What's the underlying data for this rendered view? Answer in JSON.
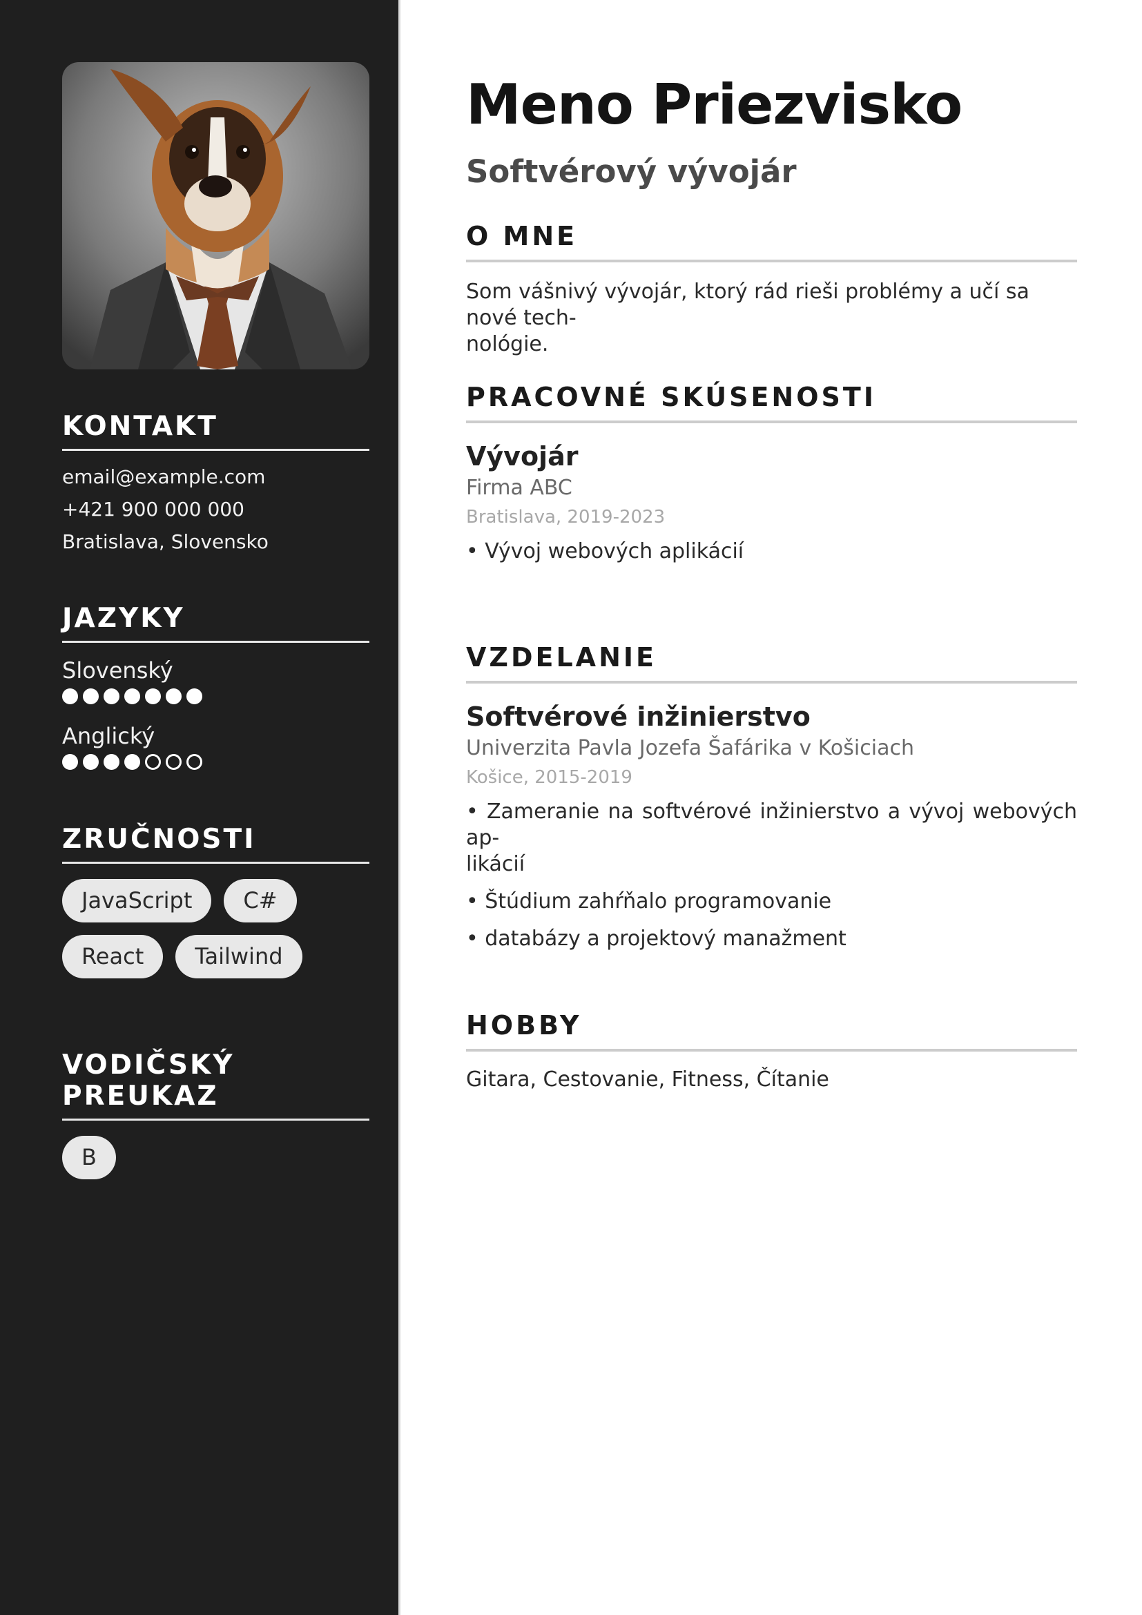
{
  "header": {
    "name": "Meno Priezvisko",
    "job_title": "Softvérový vývojár"
  },
  "contact": {
    "heading": "KONTAKT",
    "email": "email@example.com",
    "phone": "+421 900 000 000",
    "location": "Bratislava, Slovensko"
  },
  "languages": {
    "heading": "JAZYKY",
    "items": [
      {
        "name": "Slovenský",
        "level": 7,
        "max": 7
      },
      {
        "name": "Anglický",
        "level": 4,
        "max": 7
      }
    ]
  },
  "skills": {
    "heading": "ZRUČNOSTI",
    "items": [
      "JavaScript",
      "C#",
      "React",
      "Tailwind"
    ]
  },
  "license": {
    "heading": "VODIČSKÝ PREUKAZ",
    "items": [
      "B"
    ]
  },
  "about": {
    "heading": "O MNE",
    "text_line1": "Som vášnivý vývojár, ktorý rád rieši problémy a učí sa nové tech-",
    "text_line2": "nológie."
  },
  "experience": {
    "heading": "PRACOVNÉ SKÚSENOSTI",
    "title": "Vývojár",
    "company": "Firma ABC",
    "meta": "Bratislava, 2019-2023",
    "bullets": [
      "• Vývoj webových aplikácií"
    ]
  },
  "education": {
    "heading": "VZDELANIE",
    "title": "Softvérové inžinierstvo",
    "school": "Univerzita Pavla Jozefa Šafárika v Košiciach",
    "meta": "Košice, 2015-2019",
    "bullet1_line1": "• Zameranie na softvérové inžinierstvo a vývoj webových ap-",
    "bullet1_line2": "likácií",
    "bullet2": "• Štúdium zahŕňalo programovanie",
    "bullet3": "• databázy a projektový manažment"
  },
  "hobby": {
    "heading": "HOBBY",
    "text": "Gitara, Cestovanie, Fitness, Čítanie"
  },
  "colors": {
    "sidebar_bg": "#1f1f1f",
    "chip_bg": "#e8e8e8",
    "rule_main": "#cccccc"
  }
}
